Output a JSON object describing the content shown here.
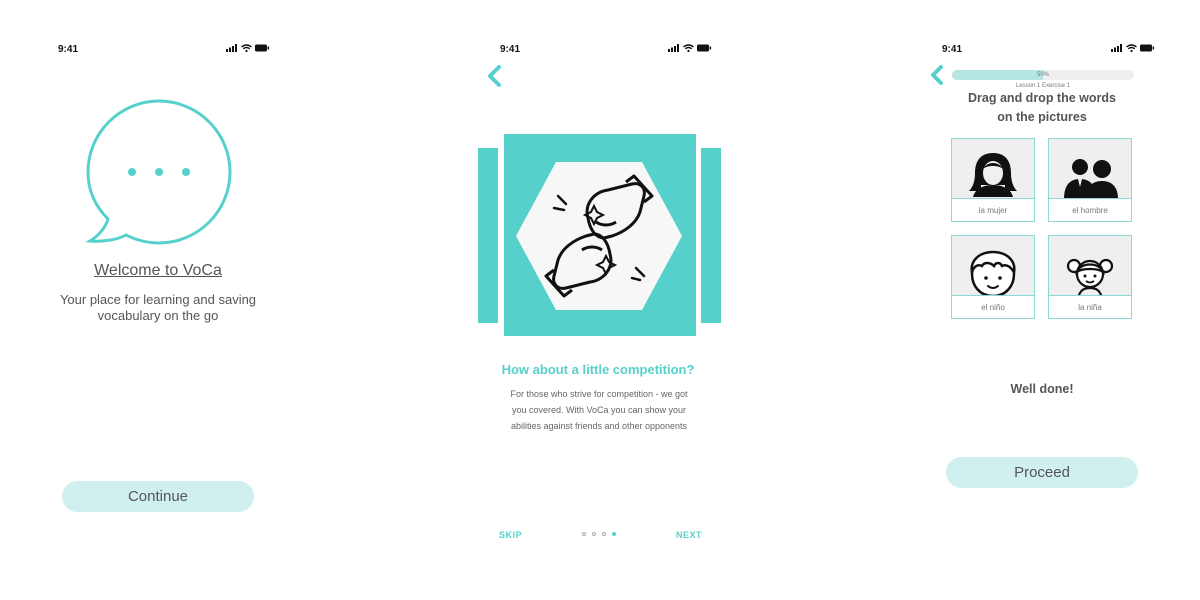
{
  "colors": {
    "accent": "#56d0cb",
    "pill_bg": "#cff0ef",
    "card_border": "#8ad9d5"
  },
  "screen1": {
    "status_time": "9:41",
    "icon": "speech-bubble-icon",
    "welcome_title": "Welcome to VoCa",
    "subtitle_line1": "Your place for learning and saving",
    "subtitle_line2": "vocabulary on the go",
    "continue_label": "Continue"
  },
  "screen2": {
    "status_time": "9:41",
    "back_icon": "chevron-left-icon",
    "hero_icon": "boxing-gloves-icon",
    "title": "How about a little competition?",
    "body_line1": "For those who strive for competition - we got",
    "body_line2": "you covered. With VoCa you can show your",
    "body_line3": "abilities against friends and other opponents",
    "skip_label": "SKIP",
    "next_label": "NEXT",
    "pagination": {
      "total": 4,
      "active": 4
    }
  },
  "screen3": {
    "status_time": "9:41",
    "back_icon": "chevron-left-icon",
    "progress_label": "50%",
    "progress_value": 0.5,
    "lesson_label": "Lesson 1 Exercise 1",
    "title_line1": "Drag and drop the words",
    "title_line2": "on the pictures",
    "cards": [
      {
        "label": "la mujer",
        "icon": "woman-icon"
      },
      {
        "label": "el hombre",
        "icon": "men-icon"
      },
      {
        "label": "el niño",
        "icon": "boy-icon"
      },
      {
        "label": "la niña",
        "icon": "girl-icon"
      }
    ],
    "feedback": "Well done!",
    "proceed_label": "Proceed"
  }
}
